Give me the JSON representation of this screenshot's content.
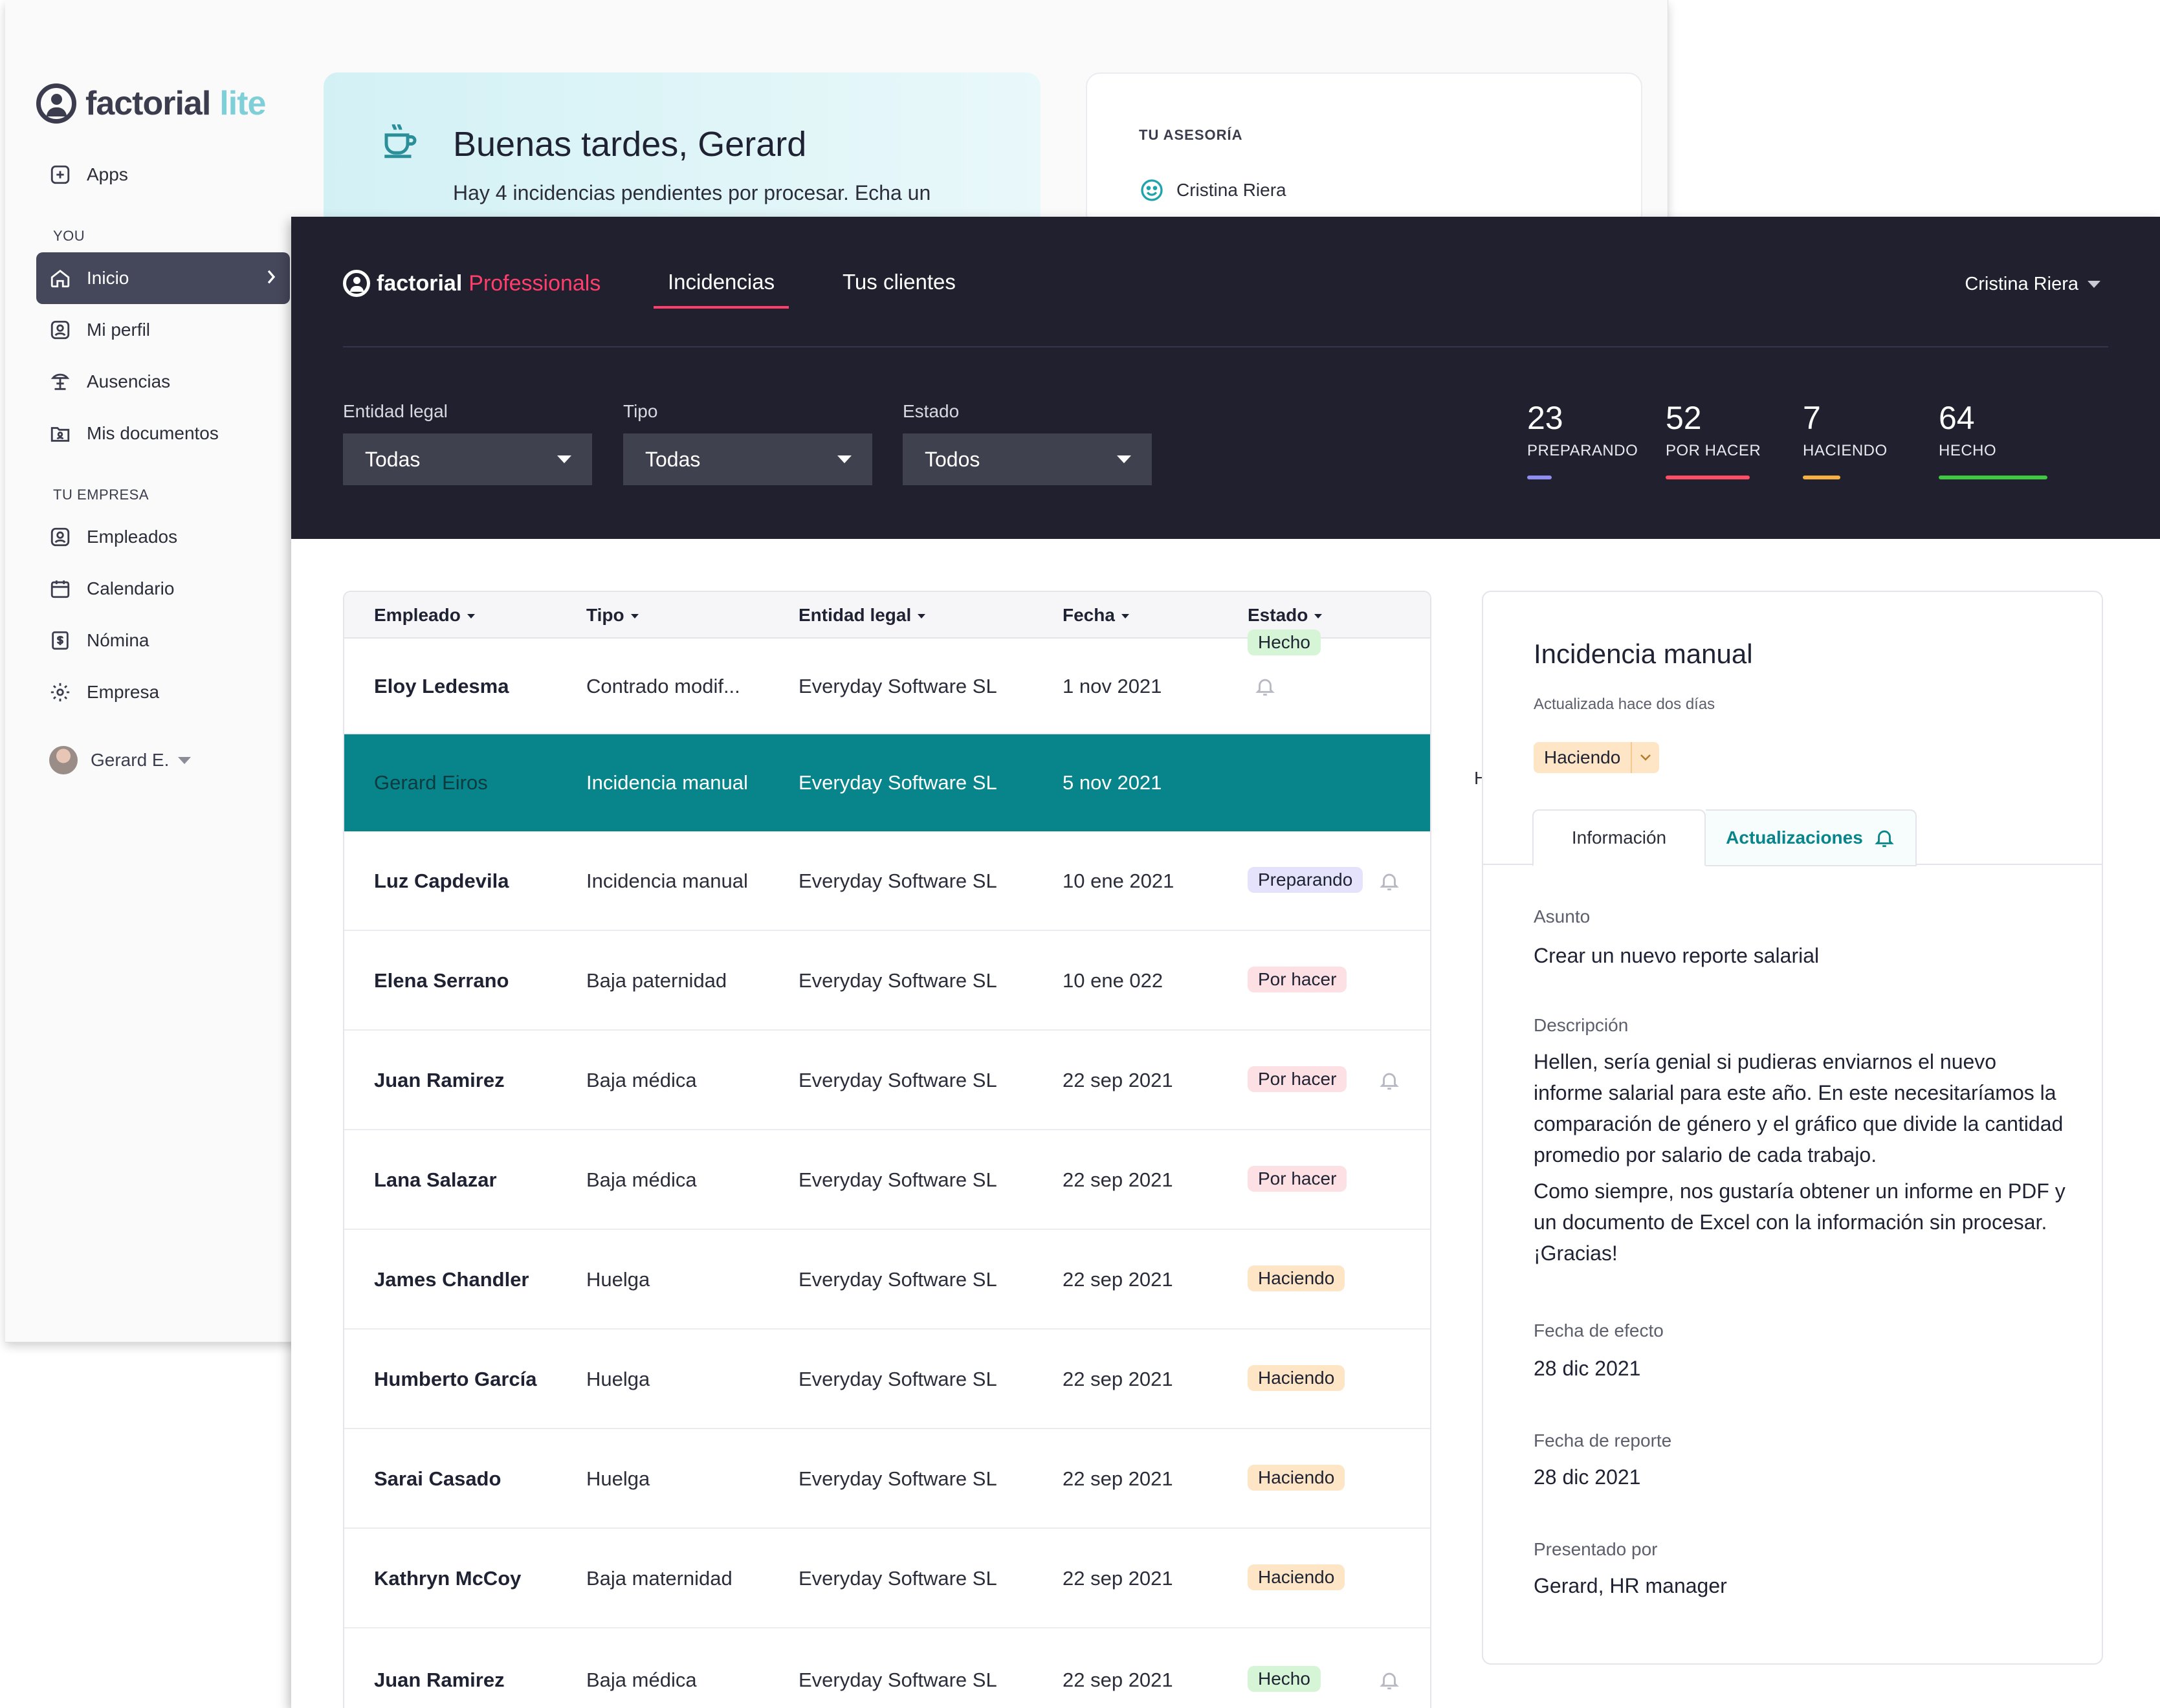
{
  "lite": {
    "logo_word1": "factorial",
    "logo_word2": "lite",
    "apps_label": "Apps",
    "section_you": "YOU",
    "you_items": [
      {
        "label": "Inicio",
        "icon": "home-icon"
      },
      {
        "label": "Mi perfil",
        "icon": "profile-icon"
      },
      {
        "label": "Ausencias",
        "icon": "beach-icon"
      },
      {
        "label": "Mis documentos",
        "icon": "folder-icon"
      }
    ],
    "section_company": "TU EMPRESA",
    "company_items": [
      {
        "label": "Empleados",
        "icon": "employees-icon"
      },
      {
        "label": "Calendario",
        "icon": "calendar-icon"
      },
      {
        "label": "Nómina",
        "icon": "payroll-icon"
      },
      {
        "label": "Empresa",
        "icon": "gear-icon"
      }
    ],
    "user_name": "Gerard E.",
    "greeting_title": "Buenas tardes, Gerard",
    "greeting_sub": "Hay 4 incidencias pendientes por procesar. Echa un",
    "advisor_label": "TU ASESORÍA",
    "advisor_name": "Cristina Riera"
  },
  "pro": {
    "logo_word1": "factorial",
    "logo_word2": "Professionals",
    "nav": [
      "Incidencias",
      "Tus clientes"
    ],
    "user_menu": "Cristina Riera",
    "filters": [
      {
        "label": "Entidad legal",
        "value": "Todas"
      },
      {
        "label": "Tipo",
        "value": "Todas"
      },
      {
        "label": "Estado",
        "value": "Todos"
      }
    ],
    "stats": [
      {
        "value": "23",
        "label": "PREPARANDO",
        "color": "#8f8cf2"
      },
      {
        "value": "52",
        "label": "POR HACER",
        "color": "#ff4d63"
      },
      {
        "value": "7",
        "label": "HACIENDO",
        "color": "#f5b041"
      },
      {
        "value": "64",
        "label": "HECHO",
        "color": "#3ec940"
      }
    ],
    "columns": [
      "Empleado",
      "Tipo",
      "Entidad legal",
      "Fecha",
      "Estado"
    ],
    "rows": [
      {
        "emp": "Eloy Ledesma",
        "tipo": "Contrado modif...",
        "ent": "Everyday Software SL",
        "fecha": "1 nov 2021",
        "estado": "Hecho"
      },
      {
        "emp": "Gerard Eiros",
        "tipo": "Incidencia manual",
        "ent": "Everyday Software SL",
        "fecha": "5 nov 2021",
        "estado": ""
      },
      {
        "emp": "Luz Capdevila",
        "tipo": "Incidencia manual",
        "ent": "Everyday Software SL",
        "fecha": "10 ene 2021",
        "estado": "Preparando"
      },
      {
        "emp": "Elena Serrano",
        "tipo": "Baja paternidad",
        "ent": "Everyday Software SL",
        "fecha": "10 ene 022",
        "estado": "Por hacer"
      },
      {
        "emp": "Juan Ramirez",
        "tipo": "Baja médica",
        "ent": "Everyday Software SL",
        "fecha": "22 sep 2021",
        "estado": "Por hacer"
      },
      {
        "emp": "Lana Salazar",
        "tipo": "Baja médica",
        "ent": "Everyday Software SL",
        "fecha": "22 sep 2021",
        "estado": "Por hacer"
      },
      {
        "emp": "James Chandler",
        "tipo": "Huelga",
        "ent": "Everyday Software SL",
        "fecha": "22 sep 2021",
        "estado": "Haciendo"
      },
      {
        "emp": "Humberto García",
        "tipo": "Huelga",
        "ent": "Everyday Software SL",
        "fecha": "22 sep 2021",
        "estado": "Haciendo"
      },
      {
        "emp": "Sarai Casado",
        "tipo": "Huelga",
        "ent": "Everyday Software SL",
        "fecha": "22 sep 2021",
        "estado": "Haciendo"
      },
      {
        "emp": "Kathryn McCoy",
        "tipo": "Baja maternidad",
        "ent": "Everyday Software SL",
        "fecha": "22 sep 2021",
        "estado": "Haciendo"
      },
      {
        "emp": "Juan Ramirez",
        "tipo": "Baja médica",
        "ent": "Everyday Software SL",
        "fecha": "22 sep 2021",
        "estado": "Hecho"
      }
    ],
    "edge_fragment": "H",
    "detail": {
      "title": "Incidencia manual",
      "updated": "Actualizada hace dos días",
      "status": "Haciendo",
      "tab_info": "Información",
      "tab_updates": "Actualizaciones",
      "asunto_label": "Asunto",
      "asunto": "Crear un nuevo reporte salarial",
      "desc_label": "Descripción",
      "desc_p1": "Hellen, sería genial si pudieras enviarnos el nuevo informe salarial para este año. En este necesitaríamos la comparación de género y el gráfico que divide la cantidad promedio por salario de cada trabajo.",
      "desc_p2": "Como siempre, nos gustaría obtener un informe en PDF y un documento de Excel con la información sin procesar. ¡Gracias!",
      "efecto_label": "Fecha de efecto",
      "efecto": "28 dic 2021",
      "reporte_label": "Fecha de reporte",
      "reporte": "28 dic 2021",
      "presentado_label": "Presentado por",
      "presentado": "Gerard, HR manager"
    }
  }
}
